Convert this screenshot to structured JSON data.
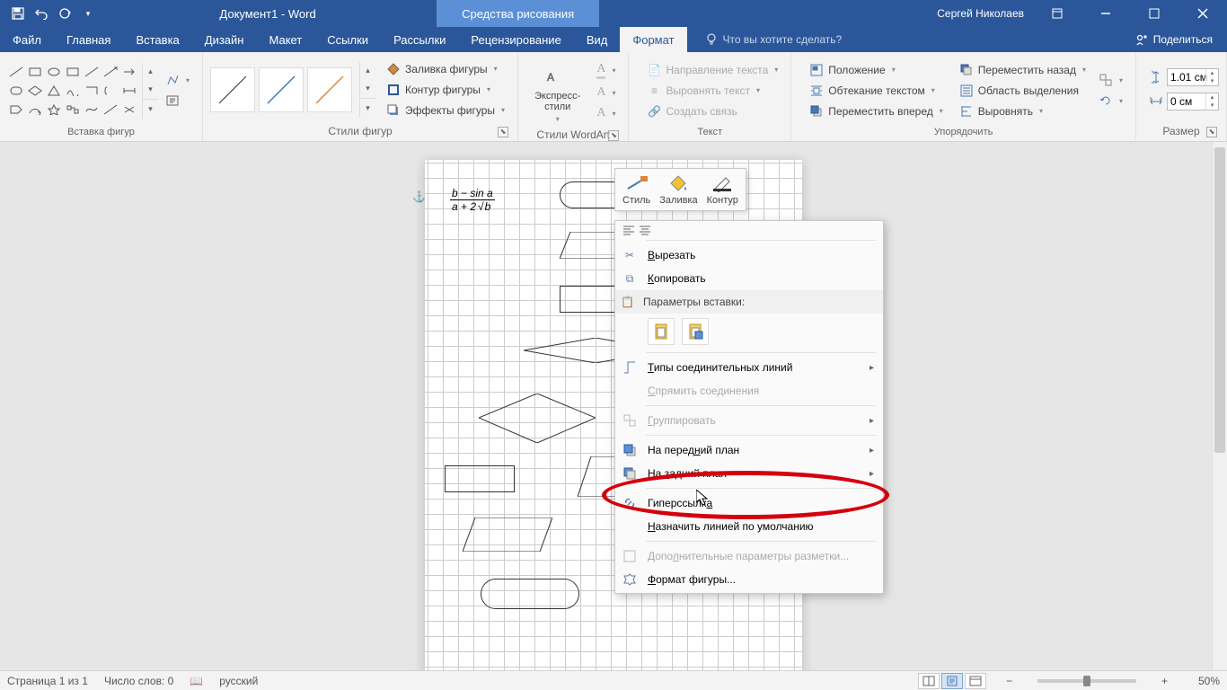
{
  "title": "Документ1 - Word",
  "context_tab": "Средства рисования",
  "user": "Сергей Николаев",
  "menubar": {
    "file": "Файл",
    "home": "Главная",
    "insert": "Вставка",
    "design": "Дизайн",
    "layout": "Макет",
    "references": "Ссылки",
    "mailings": "Рассылки",
    "review": "Рецензирование",
    "view": "Вид",
    "format": "Формат",
    "tellme": "Что вы хотите сделать?",
    "share": "Поделиться"
  },
  "ribbon": {
    "shapes_group": "Вставка фигур",
    "styles_group": "Стили фигур",
    "wordart_group": "Стили WordArt",
    "text_group": "Текст",
    "arrange_group": "Упорядочить",
    "size_group": "Размер",
    "shape_fill": "Заливка фигуры",
    "shape_outline": "Контур фигуры",
    "shape_effects": "Эффекты фигуры",
    "quick_styles": "Экспресс-стили",
    "text_direction": "Направление текста",
    "align_text": "Выровнять текст",
    "create_link": "Создать связь",
    "position": "Положение",
    "wrap_text": "Обтекание текстом",
    "bring_forward": "Переместить вперед",
    "send_backward": "Переместить назад",
    "selection_pane": "Область выделения",
    "align": "Выровнять",
    "height": "1.01 см",
    "width": "0 см"
  },
  "minitoolbar": {
    "style": "Стиль",
    "fill": "Заливка",
    "outline": "Контур"
  },
  "context_menu": {
    "cut": "Вырезать",
    "copy": "Копировать",
    "paste_header": "Параметры вставки:",
    "connector_types": "Типы соединительных линий",
    "straighten": "Спрямить соединения",
    "group": "Группировать",
    "bring_front": "На передний план",
    "send_back": "На задний план",
    "hyperlink": "Гиперссылка",
    "set_default_line": "Назначить линией по умолчанию",
    "more_layout": "Дополнительные параметры разметки...",
    "format_shape": "Формат фигуры..."
  },
  "statusbar": {
    "page": "Страница 1 из 1",
    "words": "Число слов: 0",
    "lang": "русский",
    "zoom": "50%"
  },
  "formula": {
    "top": "b − sin a",
    "bottom_a": "a + 2",
    "bottom_b": "b"
  }
}
